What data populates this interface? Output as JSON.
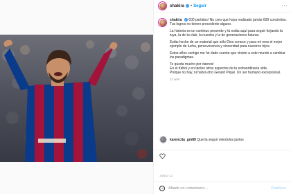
{
  "post": {
    "username": "shakira",
    "dot": "•",
    "follow_label": "Seguir",
    "more_label": "···",
    "caption": {
      "username": "shakira",
      "paragraphs": [
        "600 partidos! No creo que haya realizado jamás 600 conciertos.\nTus logros no tienen precedente alguno.",
        "La historia es un continuo presente y tú estás aquí para seguir forjando la tuya, la de tu club, la nuestra y la de generaciones futuras.",
        "Estás hecho de un material que sólo Dios conoce y para mí eres el mejor ejemplo de lucha, perseverancia y sinceridad para nuestros hijos.",
        "Estos años contigo me he dado cuenta que viniste a este mundo a cambiar los paradigmas.",
        "Te queda mucho por darnos!\nEn el fútbol y en tantos otros aspectos de tu extraordinaria vida.\nPorque no hay, ni habrá otro Gerard Piqué. Un ser humano excepcional."
      ],
      "time": "11 sem"
    },
    "comment": {
      "username": "karencita_gm89",
      "text": "Quería seguir viéndolos juntos"
    },
    "date": "JUNIO 12",
    "add_comment_placeholder": "Añade un comentario...",
    "publish_label": "Publicar"
  },
  "colors": {
    "barca_blue": "#0a3a8a",
    "barca_red": "#a3133a",
    "link_blue": "#0095f6"
  }
}
